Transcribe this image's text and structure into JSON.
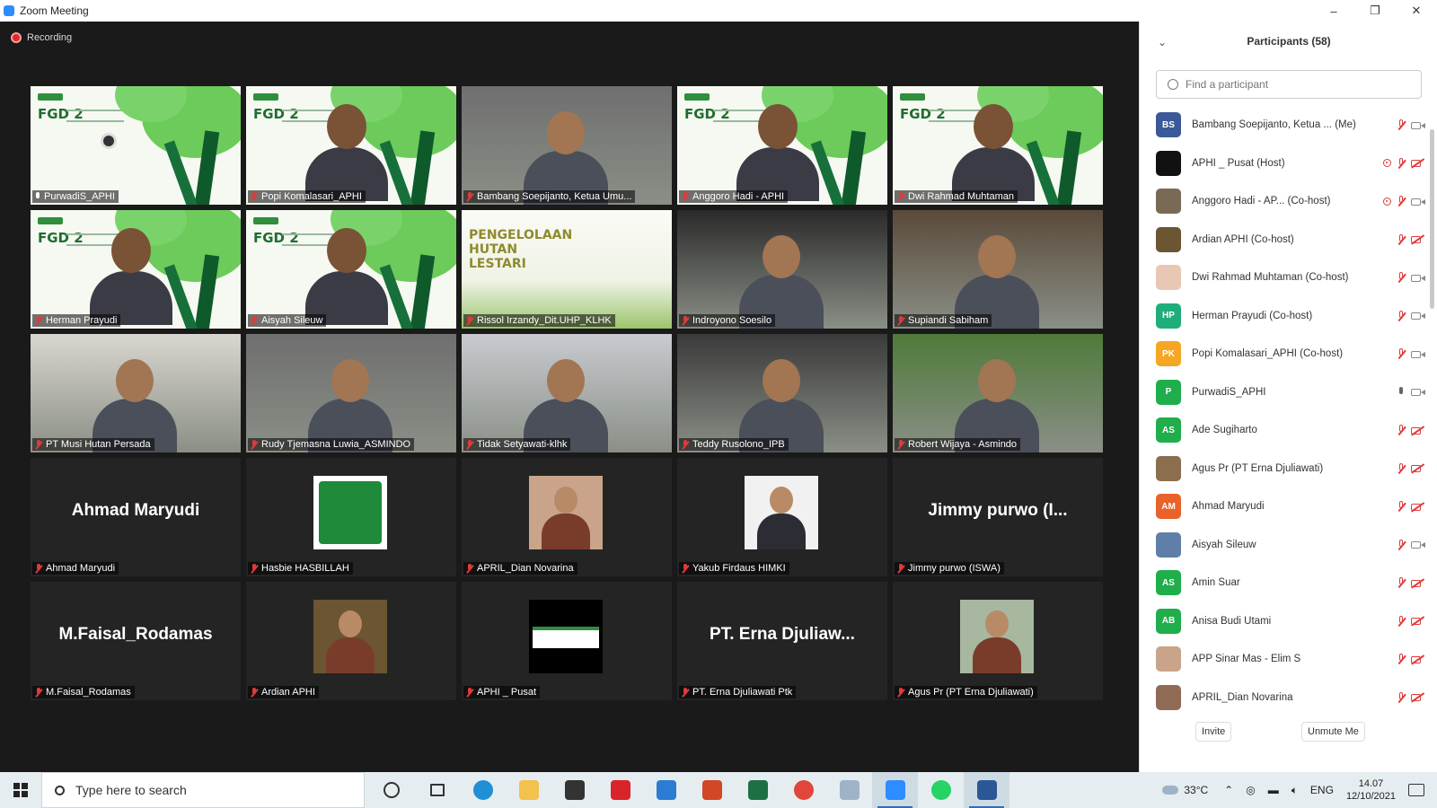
{
  "window": {
    "title": "Zoom Meeting",
    "controls": [
      "–",
      "❐",
      "✕"
    ]
  },
  "recording": {
    "label": "Recording"
  },
  "colors": {
    "accent": "#2d8cff",
    "muted_red": "#e03a3a",
    "active_speaker": "#d7e84c",
    "tile_bg": "#242424"
  },
  "tiles": [
    {
      "name": "PurwadiS_APHI",
      "kind": "fgd",
      "mic": "on",
      "active": true,
      "slide_title": "FGD 2"
    },
    {
      "name": "Popi Komalasari_APHI",
      "kind": "fgd",
      "mic": "off",
      "slide_title": "FGD 2"
    },
    {
      "name": "Bambang Soepijanto, Ketua Umu...",
      "kind": "video",
      "mic": "off"
    },
    {
      "name": "Anggoro Hadi - APHI",
      "kind": "fgd",
      "mic": "off",
      "slide_title": "FGD 2"
    },
    {
      "name": "Dwi Rahmad Muhtaman",
      "kind": "fgd",
      "mic": "off",
      "slide_title": "FGD 2"
    },
    {
      "name": "Herman Prayudi",
      "kind": "fgd",
      "mic": "off",
      "slide_title": "FGD 2"
    },
    {
      "name": "Aisyah Sileuw",
      "kind": "fgd",
      "mic": "off",
      "slide_title": "FGD 2"
    },
    {
      "name": "Rissol Irzandy_Dit.UHP_KLHK",
      "kind": "slide",
      "mic": "off",
      "slide_title": "PENGELOLAAN HUTAN LESTARI"
    },
    {
      "name": "Indroyono Soesilo",
      "kind": "video",
      "mic": "off"
    },
    {
      "name": "Supiandi Sabiham",
      "kind": "video",
      "mic": "off"
    },
    {
      "name": "PT Musi Hutan Persada",
      "kind": "video",
      "mic": "off"
    },
    {
      "name": "Rudy Tjemasna Luwia_ASMINDO",
      "kind": "video",
      "mic": "off"
    },
    {
      "name": "Tidak Setyawati-klhk",
      "kind": "video",
      "mic": "off"
    },
    {
      "name": "Teddy Rusolono_IPB",
      "kind": "video",
      "mic": "off"
    },
    {
      "name": "Robert Wijaya - Asmindo",
      "kind": "video",
      "mic": "off"
    },
    {
      "name": "Ahmad Maryudi",
      "kind": "avatar-name",
      "mic": "off",
      "display": "Ahmad Maryudi"
    },
    {
      "name": "Hasbie HASBILLAH",
      "kind": "avatar-pic",
      "mic": "off",
      "pic": "palm-logo"
    },
    {
      "name": "APRIL_Dian Novarina",
      "kind": "avatar-pic",
      "mic": "off",
      "pic": "photo-woman"
    },
    {
      "name": "Yakub Firdaus HIMKI",
      "kind": "avatar-pic",
      "mic": "off",
      "pic": "photo-man-suit"
    },
    {
      "name": "Jimmy purwo (ISWA)",
      "kind": "avatar-name",
      "mic": "off",
      "display": "Jimmy purwo (I..."
    },
    {
      "name": "M.Faisal_Rodamas",
      "kind": "avatar-name",
      "mic": "off",
      "display": "M.Faisal_Rodamas"
    },
    {
      "name": "Ardian APHI",
      "kind": "avatar-pic",
      "mic": "off",
      "pic": "photo-outdoor"
    },
    {
      "name": "APHI _ Pusat",
      "kind": "avatar-pic",
      "mic": "off",
      "pic": "aphi-logo"
    },
    {
      "name": "PT. Erna Djuliawati Ptk",
      "kind": "avatar-name",
      "mic": "off",
      "display": "PT. Erna Djuliaw..."
    },
    {
      "name": "Agus Pr (PT Erna Djuliawati)",
      "kind": "avatar-pic",
      "mic": "off",
      "pic": "photo-group"
    }
  ],
  "participants_panel": {
    "title": "Participants (58)",
    "search_placeholder": "Find a participant",
    "participants": [
      {
        "name": "Bambang Soepijanto, Ketua ... (Me)",
        "initials": "BS",
        "color": "#3b5997",
        "rec": false,
        "mic": "off",
        "cam": "on"
      },
      {
        "name": "APHI _ Pusat (Host)",
        "initials": "",
        "color": "#111111",
        "rec": true,
        "mic": "off",
        "cam": "off"
      },
      {
        "name": "Anggoro Hadi - AP... (Co-host)",
        "initials": "",
        "color": "#7a6a55",
        "rec": true,
        "mic": "off",
        "cam": "on"
      },
      {
        "name": "Ardian APHI (Co-host)",
        "initials": "",
        "color": "#6b5532",
        "rec": false,
        "mic": "off",
        "cam": "off"
      },
      {
        "name": "Dwi Rahmad Muhtaman (Co-host)",
        "initials": "",
        "color": "#e9c7b5",
        "rec": false,
        "mic": "off",
        "cam": "on"
      },
      {
        "name": "Herman Prayudi (Co-host)",
        "initials": "HP",
        "color": "#1fae7a",
        "rec": false,
        "mic": "off",
        "cam": "on"
      },
      {
        "name": "Popi Komalasari_APHI (Co-host)",
        "initials": "PK",
        "color": "#f5a623",
        "rec": false,
        "mic": "off",
        "cam": "on"
      },
      {
        "name": "PurwadiS_APHI",
        "initials": "P",
        "color": "#1fae4b",
        "rec": false,
        "mic": "on",
        "cam": "on"
      },
      {
        "name": "Ade Sugiharto",
        "initials": "AS",
        "color": "#1fae4b",
        "rec": false,
        "mic": "off",
        "cam": "off"
      },
      {
        "name": "Agus Pr (PT Erna Djuliawati)",
        "initials": "",
        "color": "#8a6e4e",
        "rec": false,
        "mic": "off",
        "cam": "off"
      },
      {
        "name": "Ahmad Maryudi",
        "initials": "AM",
        "color": "#e8622a",
        "rec": false,
        "mic": "off",
        "cam": "off"
      },
      {
        "name": "Aisyah Sileuw",
        "initials": "",
        "color": "#5f7fa8",
        "rec": false,
        "mic": "off",
        "cam": "on"
      },
      {
        "name": "Amin Suar",
        "initials": "AS",
        "color": "#1fae4b",
        "rec": false,
        "mic": "off",
        "cam": "off"
      },
      {
        "name": "Anisa Budi Utami",
        "initials": "AB",
        "color": "#1fae4b",
        "rec": false,
        "mic": "off",
        "cam": "off"
      },
      {
        "name": "APP Sinar Mas - Elim S",
        "initials": "",
        "color": "#c9a48a",
        "rec": false,
        "mic": "off",
        "cam": "off"
      },
      {
        "name": "APRIL_Dian Novarina",
        "initials": "",
        "color": "#8f6b55",
        "rec": false,
        "mic": "off",
        "cam": "off"
      }
    ],
    "invite_label": "Invite",
    "unmute_label": "Unmute Me"
  },
  "taskbar": {
    "search_placeholder": "Type here to search",
    "apps": [
      {
        "name": "cortana",
        "color": "#333333"
      },
      {
        "name": "task-view",
        "color": "#333333"
      },
      {
        "name": "edge",
        "color": "#1f8fd6"
      },
      {
        "name": "file-explorer",
        "color": "#f2c14e"
      },
      {
        "name": "store",
        "color": "#333333"
      },
      {
        "name": "mcafee",
        "color": "#d8252c"
      },
      {
        "name": "mail",
        "color": "#2b7cd3"
      },
      {
        "name": "powerpoint",
        "color": "#d24726"
      },
      {
        "name": "excel",
        "color": "#1d7044"
      },
      {
        "name": "chrome",
        "color": "#e0463a"
      },
      {
        "name": "photos",
        "color": "#9fb3c8"
      },
      {
        "name": "zoom",
        "color": "#2d8cff",
        "active": true
      },
      {
        "name": "whatsapp",
        "color": "#25d366"
      },
      {
        "name": "word",
        "color": "#2b5797",
        "active": true
      }
    ],
    "weather": "33°C",
    "language": "ENG",
    "time": "14.07",
    "date": "12/10/2021"
  }
}
